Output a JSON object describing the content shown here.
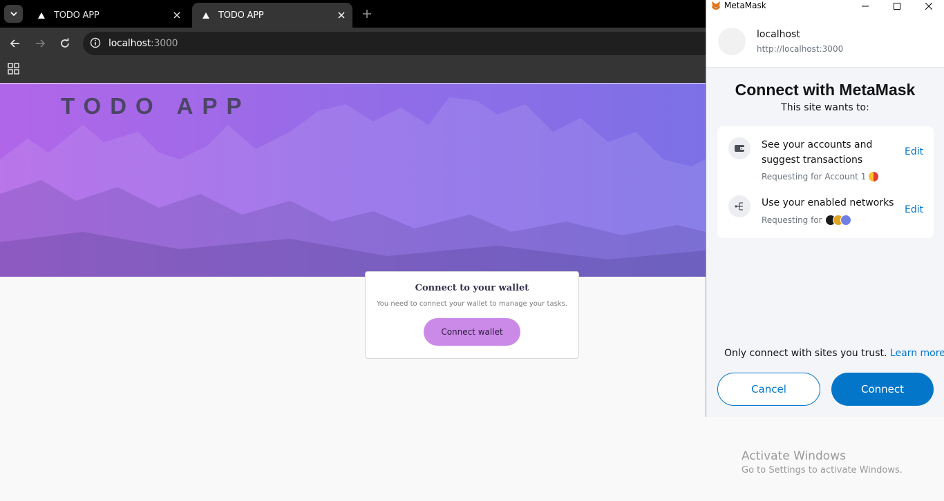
{
  "browser": {
    "tabs": [
      {
        "title": "TODO APP",
        "active": false,
        "icon": "triangle-favicon"
      },
      {
        "title": "TODO APP",
        "active": true,
        "icon": "triangle-favicon"
      }
    ],
    "url_host": "localhost",
    "url_port": ":3000"
  },
  "page": {
    "app_title": "TODO APP",
    "card_title": "Connect to your wallet",
    "card_text": "You need to connect your wallet to manage your tasks.",
    "connect_button": "Connect wallet",
    "colors": {
      "accent": "#cc8ae8",
      "hero_start": "#b166e8",
      "hero_end": "#6d72e4"
    }
  },
  "metamask": {
    "window_title": "MetaMask",
    "site_name": "localhost",
    "site_url": "http://localhost:3000",
    "heading": "Connect with MetaMask",
    "subheading": "This site wants to:",
    "permissions": [
      {
        "title": "See your accounts and suggest transactions",
        "subtitle": "Requesting for Account 1",
        "action": "Edit",
        "icon": "wallet-icon"
      },
      {
        "title": "Use your enabled networks",
        "subtitle": "Requesting for",
        "action": "Edit",
        "icon": "network-icon"
      }
    ],
    "trust_text": "Only connect with sites you trust.",
    "learn_more": "Learn more",
    "cancel": "Cancel",
    "connect": "Connect",
    "colors": {
      "primary": "#0376c9"
    }
  },
  "watermark": {
    "title": "Activate Windows",
    "subtitle": "Go to Settings to activate Windows."
  }
}
